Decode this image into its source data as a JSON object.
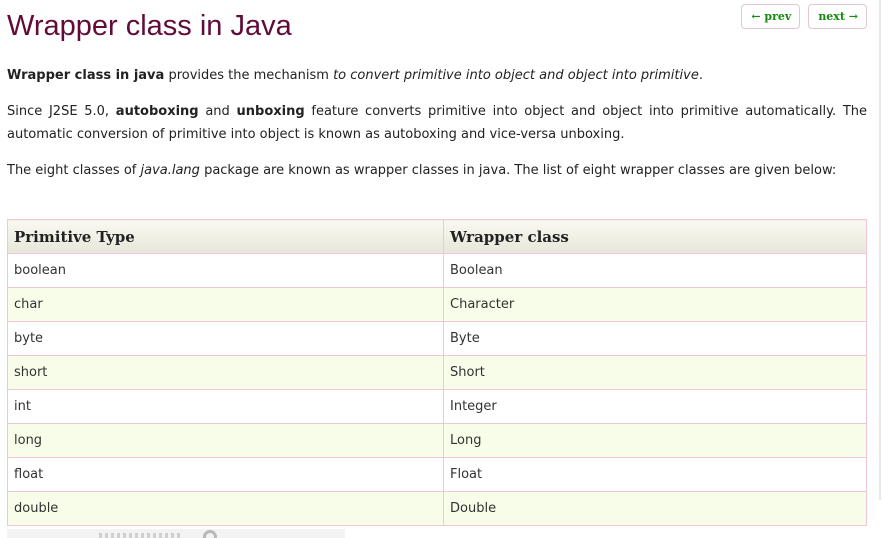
{
  "nav": {
    "prev_label": "← prev",
    "next_label": "next →"
  },
  "page_title": "Wrapper class in Java",
  "para1": {
    "strong": "Wrapper class in java",
    "text1": " provides the mechanism ",
    "em": "to convert primitive into object and object into primitive",
    "text2": "."
  },
  "para2": {
    "text1": "Since J2SE 5.0, ",
    "strong1": "autoboxing",
    "text2": " and ",
    "strong2": "unboxing",
    "text3": " feature converts primitive into object and object into primitive automatically. The automatic conversion of primitive into object is known as autoboxing and vice-versa unboxing."
  },
  "para3": {
    "text1": "The eight classes of ",
    "em": "java.lang",
    "text2": " package are known as wrapper classes in java. The list of eight wrapper classes are given below:"
  },
  "table": {
    "headers": [
      "Primitive Type",
      "Wrapper class"
    ],
    "rows": [
      [
        "boolean",
        "Boolean"
      ],
      [
        "char",
        "Character"
      ],
      [
        "byte",
        "Byte"
      ],
      [
        "short",
        "Short"
      ],
      [
        "int",
        "Integer"
      ],
      [
        "long",
        "Long"
      ],
      [
        "float",
        "Float"
      ],
      [
        "double",
        "Double"
      ]
    ]
  },
  "colors": {
    "title": "#610b38",
    "nav_text": "#16890f",
    "border": "#f1c6d5",
    "row_alt": "#f7fde8"
  }
}
